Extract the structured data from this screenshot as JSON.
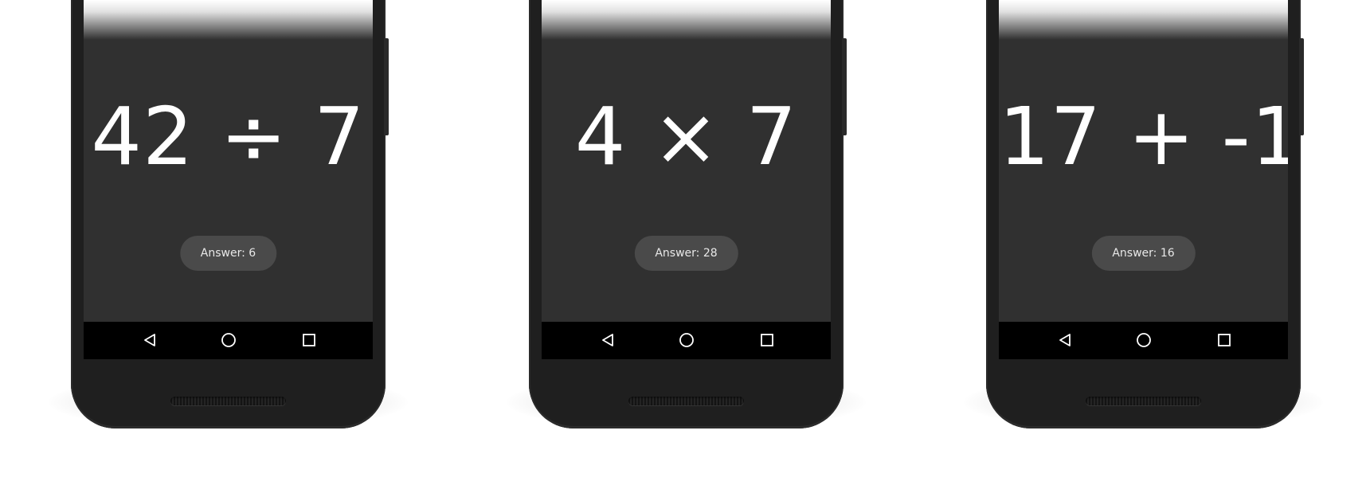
{
  "phones": [
    {
      "equation": "42 ÷ 7",
      "answer_label": "Answer: 6"
    },
    {
      "equation": "4 × 7",
      "answer_label": "Answer: 28"
    },
    {
      "equation": "17 + -1",
      "answer_label": "Answer: 16"
    }
  ],
  "nav_icons": [
    "back-icon",
    "home-icon",
    "recent-apps-icon"
  ],
  "colors": {
    "screen": "#303030",
    "chip": "#4a4a4a",
    "nav_bar": "#000000",
    "phone_body": "#1f1f1f",
    "text": "#ffffff"
  }
}
